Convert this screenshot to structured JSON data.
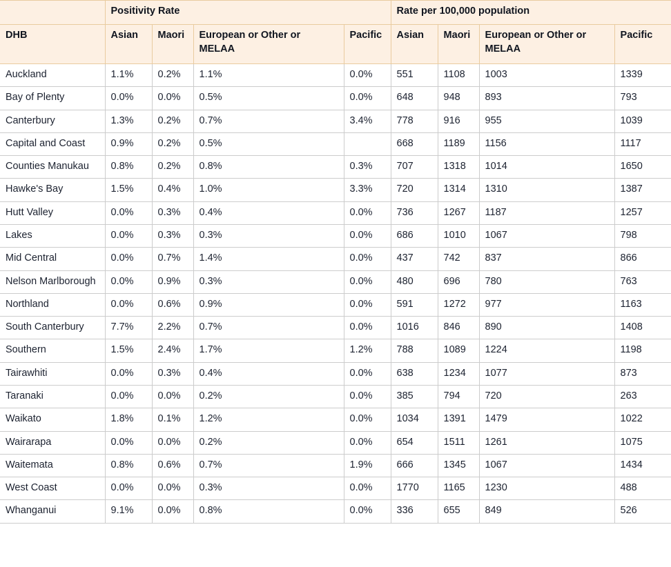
{
  "table": {
    "group_headers": [
      {
        "label": "",
        "span": 1
      },
      {
        "label": "Positivity Rate",
        "span": 4
      },
      {
        "label": "Rate per 100,000 population",
        "span": 4
      }
    ],
    "group_positivity": "Positivity Rate",
    "group_rate": "Rate per 100,000 population",
    "columns": [
      "DHB",
      "Asian",
      "Maori",
      "European or Other or MELAA",
      "Pacific",
      "Asian",
      "Maori",
      "European or Other or MELAA",
      "Pacific"
    ],
    "colors": {
      "header_background": "#fdf0e3",
      "header_border": "#e9cb9f",
      "body_border": "#cccccc",
      "text": "#1c2230",
      "body_background": "#ffffff"
    },
    "rows": [
      {
        "dhb": "Auckland",
        "pos_asian": "1.1%",
        "pos_maori": "0.2%",
        "pos_euro": "1.1%",
        "pos_pacific": "0.0%",
        "rate_asian": "551",
        "rate_maori": "1108",
        "rate_euro": "1003",
        "rate_pacific": "1339"
      },
      {
        "dhb": "Bay of Plenty",
        "pos_asian": "0.0%",
        "pos_maori": "0.0%",
        "pos_euro": "0.5%",
        "pos_pacific": "0.0%",
        "rate_asian": "648",
        "rate_maori": "948",
        "rate_euro": "893",
        "rate_pacific": "793"
      },
      {
        "dhb": "Canterbury",
        "pos_asian": "1.3%",
        "pos_maori": "0.2%",
        "pos_euro": "0.7%",
        "pos_pacific": "3.4%",
        "rate_asian": "778",
        "rate_maori": "916",
        "rate_euro": "955",
        "rate_pacific": "1039"
      },
      {
        "dhb": "Capital and Coast",
        "pos_asian": "0.9%",
        "pos_maori": "0.2%",
        "pos_euro": "0.5%",
        "pos_pacific": "",
        "rate_asian": "668",
        "rate_maori": "1189",
        "rate_euro": "1156",
        "rate_pacific": "1117"
      },
      {
        "dhb": "Counties Manukau",
        "pos_asian": "0.8%",
        "pos_maori": "0.2%",
        "pos_euro": "0.8%",
        "pos_pacific": "0.3%",
        "rate_asian": "707",
        "rate_maori": "1318",
        "rate_euro": "1014",
        "rate_pacific": "1650"
      },
      {
        "dhb": "Hawke's Bay",
        "pos_asian": "1.5%",
        "pos_maori": "0.4%",
        "pos_euro": "1.0%",
        "pos_pacific": "3.3%",
        "rate_asian": "720",
        "rate_maori": "1314",
        "rate_euro": "1310",
        "rate_pacific": "1387"
      },
      {
        "dhb": "Hutt Valley",
        "pos_asian": "0.0%",
        "pos_maori": "0.3%",
        "pos_euro": "0.4%",
        "pos_pacific": "0.0%",
        "rate_asian": "736",
        "rate_maori": "1267",
        "rate_euro": "1187",
        "rate_pacific": "1257"
      },
      {
        "dhb": "Lakes",
        "pos_asian": "0.0%",
        "pos_maori": "0.3%",
        "pos_euro": "0.3%",
        "pos_pacific": "0.0%",
        "rate_asian": "686",
        "rate_maori": "1010",
        "rate_euro": "1067",
        "rate_pacific": "798"
      },
      {
        "dhb": "Mid Central",
        "pos_asian": "0.0%",
        "pos_maori": "0.7%",
        "pos_euro": "1.4%",
        "pos_pacific": "0.0%",
        "rate_asian": "437",
        "rate_maori": "742",
        "rate_euro": "837",
        "rate_pacific": "866"
      },
      {
        "dhb": "Nelson Marlborough",
        "pos_asian": "0.0%",
        "pos_maori": "0.9%",
        "pos_euro": "0.3%",
        "pos_pacific": "0.0%",
        "rate_asian": "480",
        "rate_maori": "696",
        "rate_euro": "780",
        "rate_pacific": "763"
      },
      {
        "dhb": "Northland",
        "pos_asian": "0.0%",
        "pos_maori": "0.6%",
        "pos_euro": "0.9%",
        "pos_pacific": "0.0%",
        "rate_asian": "591",
        "rate_maori": "1272",
        "rate_euro": "977",
        "rate_pacific": "1163"
      },
      {
        "dhb": "South Canterbury",
        "pos_asian": "7.7%",
        "pos_maori": "2.2%",
        "pos_euro": "0.7%",
        "pos_pacific": "0.0%",
        "rate_asian": "1016",
        "rate_maori": "846",
        "rate_euro": "890",
        "rate_pacific": "1408"
      },
      {
        "dhb": "Southern",
        "pos_asian": "1.5%",
        "pos_maori": "2.4%",
        "pos_euro": "1.7%",
        "pos_pacific": "1.2%",
        "rate_asian": "788",
        "rate_maori": "1089",
        "rate_euro": "1224",
        "rate_pacific": "1198"
      },
      {
        "dhb": "Tairawhiti",
        "pos_asian": "0.0%",
        "pos_maori": "0.3%",
        "pos_euro": "0.4%",
        "pos_pacific": "0.0%",
        "rate_asian": "638",
        "rate_maori": "1234",
        "rate_euro": "1077",
        "rate_pacific": "873"
      },
      {
        "dhb": "Taranaki",
        "pos_asian": "0.0%",
        "pos_maori": "0.0%",
        "pos_euro": "0.2%",
        "pos_pacific": "0.0%",
        "rate_asian": "385",
        "rate_maori": "794",
        "rate_euro": "720",
        "rate_pacific": "263"
      },
      {
        "dhb": "Waikato",
        "pos_asian": "1.8%",
        "pos_maori": "0.1%",
        "pos_euro": "1.2%",
        "pos_pacific": "0.0%",
        "rate_asian": "1034",
        "rate_maori": "1391",
        "rate_euro": "1479",
        "rate_pacific": "1022"
      },
      {
        "dhb": "Wairarapa",
        "pos_asian": "0.0%",
        "pos_maori": "0.0%",
        "pos_euro": "0.2%",
        "pos_pacific": "0.0%",
        "rate_asian": "654",
        "rate_maori": "1511",
        "rate_euro": "1261",
        "rate_pacific": "1075"
      },
      {
        "dhb": "Waitemata",
        "pos_asian": "0.8%",
        "pos_maori": "0.6%",
        "pos_euro": "0.7%",
        "pos_pacific": "1.9%",
        "rate_asian": "666",
        "rate_maori": "1345",
        "rate_euro": "1067",
        "rate_pacific": "1434"
      },
      {
        "dhb": "West Coast",
        "pos_asian": "0.0%",
        "pos_maori": "0.0%",
        "pos_euro": "0.3%",
        "pos_pacific": "0.0%",
        "rate_asian": "1770",
        "rate_maori": "1165",
        "rate_euro": "1230",
        "rate_pacific": "488"
      },
      {
        "dhb": "Whanganui",
        "pos_asian": "9.1%",
        "pos_maori": "0.0%",
        "pos_euro": "0.8%",
        "pos_pacific": "0.0%",
        "rate_asian": "336",
        "rate_maori": "655",
        "rate_euro": "849",
        "rate_pacific": "526"
      }
    ]
  }
}
